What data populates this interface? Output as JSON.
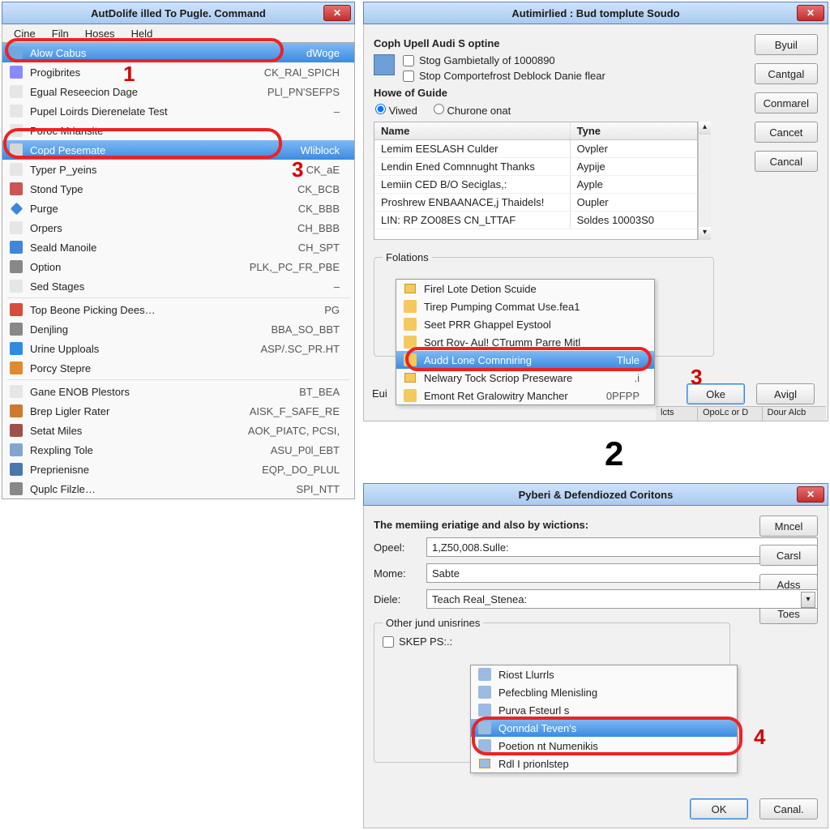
{
  "colors": {
    "accent": "#3b8be0",
    "danger": "#e22"
  },
  "callouts": {
    "one": "1",
    "two": "2",
    "three": "3",
    "threeAlt": "3",
    "four": "4"
  },
  "panel1": {
    "title": "AutDolife illed To Pugle. Command",
    "menubar": [
      "Cine",
      "Filn",
      "Hoses",
      "Held"
    ],
    "items": [
      {
        "icon": "page-icon",
        "iconColor": "#6fa9e0",
        "label": "Alow Cabus",
        "accel": "dWoge",
        "selected": true
      },
      {
        "icon": "gear-icon",
        "iconColor": "#8a8aff",
        "label": "Progibrites",
        "accel": "CK_RAl_SPICH"
      },
      {
        "icon": "page-icon",
        "iconColor": "#e6e6e6",
        "label": "Egual Reseecion Dage",
        "accel": "PLl_PN'SEFPS"
      },
      {
        "icon": "page-icon",
        "iconColor": "#e6e6e6",
        "label": "Pupel Loirds Dierenelate Test",
        "accel": "–"
      },
      {
        "icon": "page-icon",
        "iconColor": "#e6e6e6",
        "label": "Poroc Mriansite",
        "accel": ""
      },
      {
        "icon": "copy-icon",
        "iconColor": "#d6d6d6",
        "label": "Copd Pesemate",
        "accel": "Wliblock",
        "selected": true,
        "ringed": true
      },
      {
        "icon": "text-icon",
        "iconColor": "#e6e6e6",
        "label": "Typer P_yeins",
        "accel": "CK_aE"
      },
      {
        "icon": "play-icon",
        "iconColor": "#cc5555",
        "label": "Stond Type",
        "accel": "CK_BCB"
      },
      {
        "icon": "diamond-icon",
        "iconColor": "#3f87d9",
        "label": "Purge",
        "accel": "CK_BBB"
      },
      {
        "icon": "page-icon",
        "iconColor": "#e6e6e6",
        "label": "Orpers",
        "accel": "CH_BBB"
      },
      {
        "icon": "cylinder-icon",
        "iconColor": "#3f87d9",
        "label": "Seald Manoile",
        "accel": "CH_SPT"
      },
      {
        "icon": "gear-icon",
        "iconColor": "#888",
        "label": "Option",
        "accel": "PLK,_PC_FR_PBE"
      },
      {
        "icon": "page-icon",
        "iconColor": "#e6e6e6",
        "label": "Sed Stages",
        "accel": "–"
      },
      {
        "sep": true
      },
      {
        "icon": "pdf-icon",
        "iconColor": "#d94b3a",
        "label": "Top Beone Picking Dees…",
        "accel": "PG"
      },
      {
        "icon": "gear-icon",
        "iconColor": "#888",
        "label": "Denjling",
        "accel": "BBA_SO_BBT"
      },
      {
        "icon": "globe-icon",
        "iconColor": "#2f8de0",
        "label": "Urine Upploals",
        "accel": "ASP/.SC_PR.HT"
      },
      {
        "icon": "arrow-icon",
        "iconColor": "#e08a2f",
        "label": "Porcy Stepre",
        "accel": ""
      },
      {
        "sep": true
      },
      {
        "icon": "page-icon",
        "iconColor": "#e6e6e6",
        "label": "Gane ENOB Plestors",
        "accel": "BT_BEA"
      },
      {
        "icon": "pen-icon",
        "iconColor": "#cc7a2f",
        "label": "Brep Ligler Rater",
        "accel": "AISK_F_SAFE_RE"
      },
      {
        "icon": "wrench-icon",
        "iconColor": "#a0504a",
        "label": "Setat Miles",
        "accel": "AOK_PIATC, PCSI,"
      },
      {
        "icon": "page-icon",
        "iconColor": "#82a6cf",
        "label": "Rexpling Tole",
        "accel": "ASU_P0l_EBT"
      },
      {
        "icon": "page-icon",
        "iconColor": "#4a77ad",
        "label": "Preprienisne",
        "accel": "EQP,_DO_PLUL"
      },
      {
        "icon": "arrow-icon",
        "iconColor": "#888",
        "label": "Quplc Filzle…",
        "accel": "SPI_NTT"
      }
    ]
  },
  "panel2": {
    "title": "Autimirlied : Bud tomplute Soudo",
    "groupLabel": "Coph Upell Audi S optine",
    "checks": [
      "Stog Gambietally of 1000890",
      "Stop Comportefrost Deblock Danie flear"
    ],
    "subHeading": "Howe of Guide",
    "radios": [
      "Viwed",
      "Churone onat"
    ],
    "tableHeaders": [
      "Name",
      "Tyne"
    ],
    "tableRows": [
      {
        "name": "Lemim EESLASH Culder",
        "type": "Ovpler"
      },
      {
        "name": "Lendin Ened Comnnught Thanks",
        "type": "Aypije"
      },
      {
        "name": "Lemiin CED B/O Seciglas,:",
        "type": "Ayple"
      },
      {
        "name": "Proshrew ENBAANACE,j Thaidels!",
        "type": "Oupler"
      },
      {
        "name": "LIN: RP ZO08ES CN_LTTAF",
        "type": "Soldes 10003S0"
      }
    ],
    "buttons": [
      "Byuil",
      "Cantgal",
      "Conmarel",
      "Cancet",
      "Cancal"
    ],
    "fieldsetLegend": "Folations",
    "euiLabel": "Eui",
    "bottomButtons": [
      "Oke",
      "Avigl"
    ],
    "statusItems": [
      "lcts",
      "OpoLc or D",
      "Dour Alcb"
    ],
    "context": [
      {
        "icon": "folder-icon",
        "label": "Firel Lote Detion Scuide",
        "accel": ""
      },
      {
        "icon": "page-icon",
        "label": "Tirep Pumping Commat Use.fea1",
        "accel": ""
      },
      {
        "icon": "page-icon",
        "label": "Seet PRR Ghappel Eystool",
        "accel": ""
      },
      {
        "icon": "page-icon",
        "label": "Sort Rov- Aul! CTrumm Parre Mitl",
        "accel": ""
      },
      {
        "icon": "page-icon",
        "label": "Audd Lone Comnniring",
        "accel": "Tlule",
        "selected": true,
        "ringed": true
      },
      {
        "icon": "folder-icon",
        "label": "Nelwary Tock Scriop Preseware",
        "accel": ".i"
      },
      {
        "icon": "page-icon",
        "label": "Emont Ret Gralowitry Mancher",
        "accel": "0PFPP"
      }
    ]
  },
  "panel3": {
    "title": "Pyberi & Defendiozed Coritons",
    "heading": "The memiing eriatige and also by wictions:",
    "buttonsRight": [
      "Mncel",
      "Carsl",
      "Adss",
      "Toes"
    ],
    "fields": {
      "opeel_label": "Opeel:",
      "opeel_value": "1,Z50,008.Sulle:",
      "mome_label": "Mome:",
      "mome_value": "Sabte",
      "diele_label": "Diele:",
      "diele_value": "Teach Real_Stenea:"
    },
    "fieldset": "Other jund unisrines",
    "checkbox_label": "SKEP PS:.:",
    "dropdown": [
      {
        "icon": "page-icon",
        "label": "Riost Llurrls"
      },
      {
        "icon": "gear-icon",
        "label": "Pefecbling Mlenisling"
      },
      {
        "icon": "page-icon",
        "label": "Purva Fsteurl s"
      },
      {
        "icon": "page-icon",
        "label": "Qonndal Teven's",
        "selected": true,
        "ringed": true
      },
      {
        "icon": "page-icon",
        "label": "Poetion nt Numenikis"
      },
      {
        "icon": "folder-icon",
        "label": "Rdl I prionlstep"
      }
    ],
    "bottomButtons": [
      "OK",
      "Canal."
    ]
  }
}
